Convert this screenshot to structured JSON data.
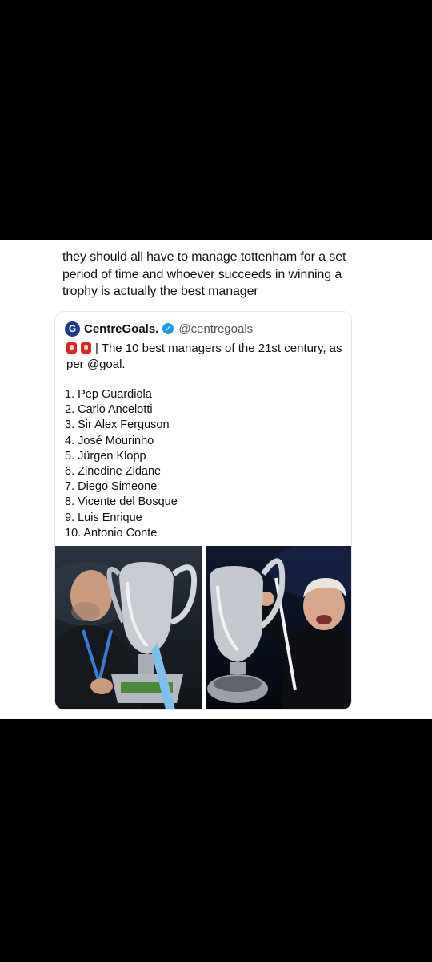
{
  "tweet": {
    "text": "they should all have to manage tottenham for a set period of time and whoever succeeds in winning a trophy is actually the best manager"
  },
  "quote": {
    "logo_letter": "G",
    "source_name": "CentreGoals.",
    "verified_mark": "✓",
    "handle": "@centregoals",
    "headline": "| The 10 best managers of the 21st century, as per @goal.",
    "list": [
      "1. Pep Guardiola",
      "2. Carlo Ancelotti",
      "3. Sir Alex Ferguson",
      "4. José Mourinho",
      "5. Jürgen Klopp",
      "6. Zinedine Zidane",
      "7. Diego Simeone",
      "8. Vicente del Bosque",
      "9. Luis Enrique",
      "10. Antonio Conte"
    ]
  },
  "colors": {
    "brand_logo": "#1f3a8c",
    "verified_badge": "#1d9bf0",
    "siren_emoji": "#d92626"
  },
  "icons": [
    "centregoals-logo-icon",
    "verified-badge-icon",
    "siren-icon"
  ]
}
